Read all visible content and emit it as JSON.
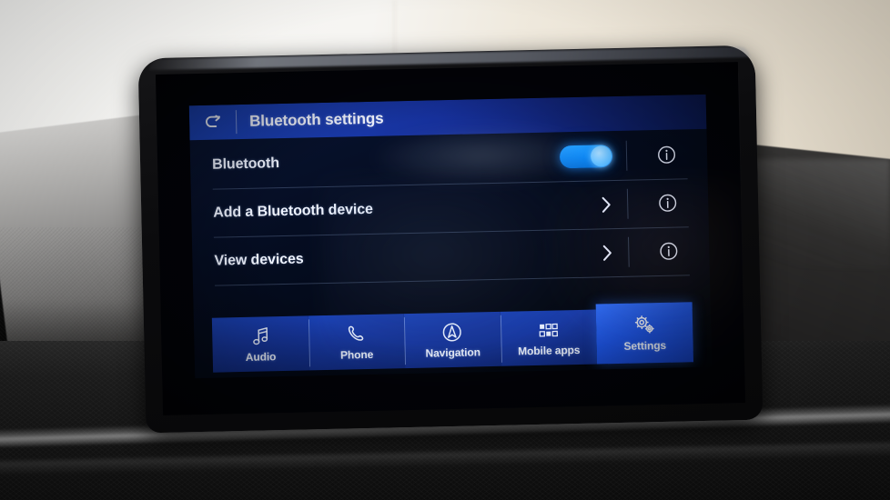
{
  "header": {
    "title": "Bluetooth settings",
    "back_icon": "back-arrow-icon"
  },
  "list": {
    "rows": [
      {
        "label": "Bluetooth",
        "control": "toggle",
        "toggle_state": "on",
        "info_icon": "info-icon"
      },
      {
        "label": "Add a Bluetooth device",
        "control": "chevron",
        "info_icon": "info-icon"
      },
      {
        "label": "View devices",
        "control": "chevron",
        "info_icon": "info-icon"
      }
    ]
  },
  "navbar": {
    "items": [
      {
        "label": "Audio",
        "icon": "music-note-icon",
        "active": false
      },
      {
        "label": "Phone",
        "icon": "phone-handset-icon",
        "active": false
      },
      {
        "label": "Navigation",
        "icon": "navigation-compass-icon",
        "active": false
      },
      {
        "label": "Mobile apps",
        "icon": "app-grid-icon",
        "active": false
      },
      {
        "label": "Settings",
        "icon": "gears-icon",
        "active": true
      }
    ]
  },
  "colors": {
    "header_blue": "#1b43b8",
    "nav_blue": "#17379f",
    "nav_active_blue": "#2f6cf5",
    "toggle_on": "#0d86f2",
    "toggle_knob": "#6cc2ff",
    "text": "#eef3ff",
    "screen_bg": "#050d22"
  }
}
